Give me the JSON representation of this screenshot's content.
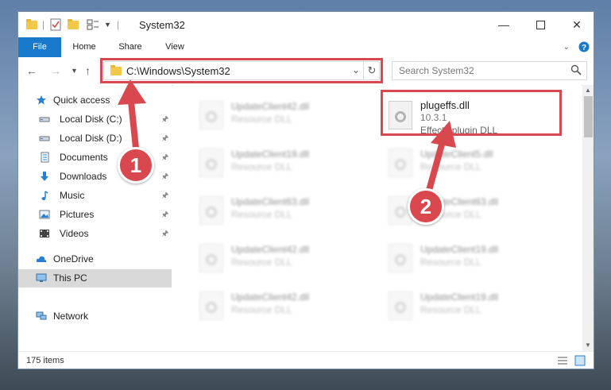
{
  "window": {
    "title": "System32"
  },
  "ribbon": {
    "tabs": [
      "File",
      "Home",
      "Share",
      "View"
    ]
  },
  "nav": {
    "address": "C:\\Windows\\System32",
    "search_placeholder": "Search System32"
  },
  "sidebar": {
    "quick_access": "Quick access",
    "items": [
      {
        "label": "Local Disk (C:)",
        "icon": "drive-icon"
      },
      {
        "label": "Local Disk (D:)",
        "icon": "drive-icon"
      },
      {
        "label": "Documents",
        "icon": "documents-icon"
      },
      {
        "label": "Downloads",
        "icon": "downloads-icon"
      },
      {
        "label": "Music",
        "icon": "music-icon"
      },
      {
        "label": "Pictures",
        "icon": "pictures-icon"
      },
      {
        "label": "Videos",
        "icon": "videos-icon"
      }
    ],
    "onedrive": "OneDrive",
    "thispc": "This PC",
    "network": "Network"
  },
  "files": [
    {
      "name": "UpdateClient42.dll",
      "type": "Resource DLL"
    },
    {
      "name": "plugeffs.dll",
      "version": "10.3.1",
      "type": "Effects plugin DLL"
    },
    {
      "name": "UpdateClient19.dll",
      "type": "Resource DLL"
    },
    {
      "name": "UpdateClient5.dll",
      "type": "Resource DLL"
    },
    {
      "name": "UpdateClient63.dll",
      "type": "Resource DLL"
    },
    {
      "name": "UpdateClient63.dll",
      "type": "Resource DLL"
    },
    {
      "name": "UpdateClient42.dll",
      "type": "Resource DLL"
    },
    {
      "name": "UpdateClient19.dll",
      "type": "Resource DLL"
    },
    {
      "name": "UpdateClient42.dll",
      "type": "Resource DLL"
    },
    {
      "name": "UpdateClient19.dll",
      "type": "Resource DLL"
    }
  ],
  "status": {
    "count": "175 items"
  },
  "callouts": {
    "one": "1",
    "two": "2"
  },
  "colors": {
    "accent": "#1979ca",
    "highlight": "#d9484f"
  }
}
